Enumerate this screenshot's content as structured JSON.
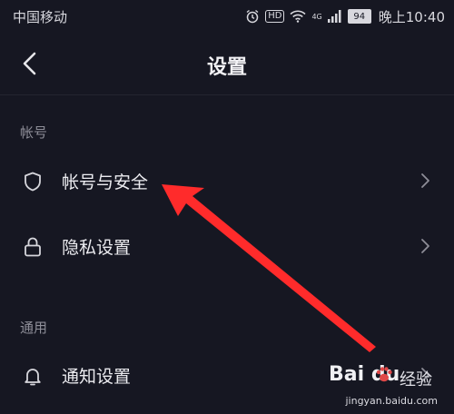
{
  "status": {
    "carrier": "中国移动",
    "hd": "HD",
    "network": "4G",
    "battery": "94",
    "time": "晚上10:40"
  },
  "header": {
    "title": "设置"
  },
  "sections": [
    {
      "label": "帐号",
      "items": [
        {
          "label": "帐号与安全",
          "icon": "shield-icon"
        },
        {
          "label": "隐私设置",
          "icon": "lock-icon"
        }
      ]
    },
    {
      "label": "通用",
      "items": [
        {
          "label": "通知设置",
          "icon": "bell-icon"
        }
      ]
    }
  ],
  "watermark": {
    "brand": "Bai du",
    "suffix": "经验",
    "url": "jingyan.baidu.com"
  },
  "colors": {
    "background": "#161722",
    "annotation_arrow": "#ff2b2b"
  }
}
